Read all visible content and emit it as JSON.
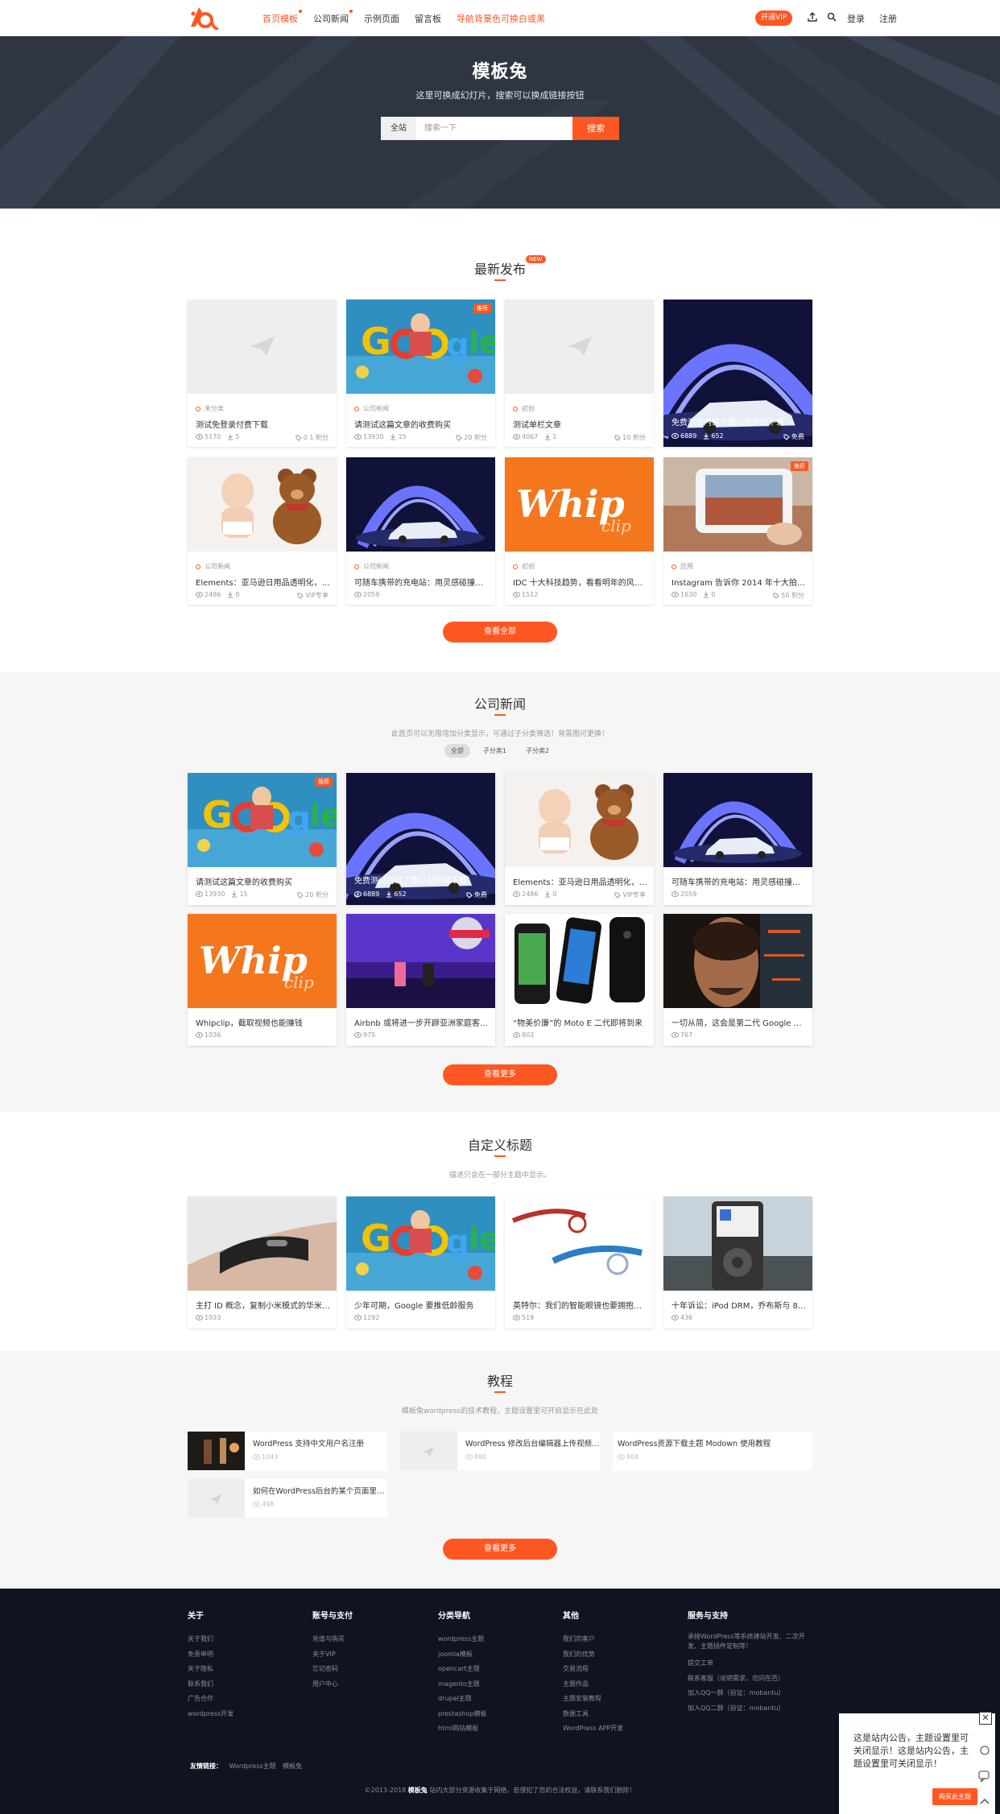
{
  "nav": {
    "items": [
      {
        "label": "首页模板",
        "active": true,
        "dot": true
      },
      {
        "label": "公司新闻",
        "dot": true
      },
      {
        "label": "示例页面"
      },
      {
        "label": "留言板"
      },
      {
        "label": "导航背景色可换白或黑",
        "highlight": true
      }
    ],
    "vip": "开通VIP",
    "login": "登录",
    "register": "注册"
  },
  "hero": {
    "title": "模板兔",
    "subtitle": "这里可换成幻灯片，搜索可以换成链接按钮",
    "search_scope": "全站",
    "search_placeholder": "搜索一下",
    "search_button": "搜索"
  },
  "latest": {
    "title": "最新发布",
    "badge": "NEW",
    "more": "查看全部",
    "cards": [
      {
        "cat": "未分类",
        "title": "测试免登录付费下载",
        "views": "5170",
        "downloads": "5",
        "price": "0.1 积分",
        "img": "placeholder"
      },
      {
        "cat": "公司新闻",
        "title": "请测试这篇文章的收费购买",
        "views": "13930",
        "downloads": "15",
        "price": "20 积分",
        "img": "google",
        "rec": "推荐"
      },
      {
        "cat": "初创",
        "title": "测试单栏文章",
        "views": "4067",
        "downloads": "1",
        "price": "10 积分",
        "img": "placeholder"
      },
      {
        "title": "免费测试内链下载以及外链下载",
        "views": "6889",
        "downloads": "652",
        "price": "免费",
        "img": "car",
        "overlay": true
      },
      {
        "cat": "公司新闻",
        "title": "Elements：亚马逊日用品透明化，…",
        "views": "2486",
        "downloads": "0",
        "price": "VIP专享",
        "img": "baby"
      },
      {
        "cat": "公司新闻",
        "title": "可随车携带的充电站：用灵感碰撞优雅",
        "views": "2059",
        "img": "car"
      },
      {
        "cat": "初创",
        "title": "IDC 十大科技趋势，看看明年的风往…",
        "views": "1512",
        "img": "whip"
      },
      {
        "cat": "应用",
        "title": "Instagram 告诉你 2014 年十大拍照…",
        "views": "1630",
        "downloads": "0",
        "price": "50 积分",
        "img": "phone",
        "rec": "推荐"
      }
    ]
  },
  "news": {
    "title": "公司新闻",
    "desc": "此首页可以无限增加分类显示，可通过子分类筛选！背景图可更换！",
    "filters": [
      "全部",
      "子分类1",
      "子分类2"
    ],
    "more": "查看更多",
    "cards": [
      {
        "title": "请测试这篇文章的收费购买",
        "views": "13930",
        "downloads": "15",
        "price": "20 积分",
        "img": "google",
        "rec": "推荐"
      },
      {
        "title": "免费测试内链下载以及外链下载",
        "views": "6889",
        "downloads": "652",
        "price": "免费",
        "img": "car",
        "overlay": true
      },
      {
        "title": "Elements：亚马逊日用品透明化，…",
        "views": "2486",
        "downloads": "0",
        "price": "VIP专享",
        "img": "baby"
      },
      {
        "title": "可随车携带的充电站：用灵感碰撞优雅",
        "views": "2059",
        "img": "car"
      },
      {
        "title": "Whipclip，截取视频也能赚钱",
        "views": "1036",
        "img": "whip"
      },
      {
        "title": "Airbnb 或将进一步开辟亚洲家庭客…",
        "views": "975",
        "img": "stage"
      },
      {
        "title": "“物美价廉”的 Moto E 二代即将到来",
        "views": "803",
        "img": "moto"
      },
      {
        "title": "一切从简，这会是第二代 Google Gl…",
        "views": "767",
        "img": "ironman"
      }
    ]
  },
  "custom": {
    "title": "自定义标题",
    "desc": "描述只会在一部分主题中显示。",
    "cards": [
      {
        "title": "主打 ID 概念，复制小米模式的华米…",
        "views": "1033",
        "img": "band"
      },
      {
        "title": "少年可期，Google 要推低龄服务",
        "views": "1292",
        "img": "google"
      },
      {
        "title": "英特尔：我们的智能眼镜也要拥抱时尚",
        "views": "519",
        "img": "glasses"
      },
      {
        "title": "十年诉讼：iPod DRM，乔布斯与 8…",
        "views": "436",
        "img": "ipod"
      }
    ]
  },
  "tutorial": {
    "title": "教程",
    "desc": "模板兔wordpress的技术教程，主题设置里可开启显示在此处",
    "more": "查看更多",
    "items": [
      {
        "title": "WordPress 支持中文用户名注册",
        "views": "1043",
        "img": "dark"
      },
      {
        "title": "WordPress 修改后台编辑器上传视频…",
        "views": "880",
        "img": "placeholder"
      },
      {
        "title": "WordPress资源下载主题 Modown 使用教程",
        "views": "804"
      },
      {
        "title": "如何在WordPress后台的某个页面里…",
        "views": "498",
        "img": "placeholder"
      }
    ]
  },
  "footer": {
    "cols": [
      {
        "head": "关于",
        "links": [
          "关于我们",
          "免责申明",
          "关于隐私",
          "联系我们",
          "广告合作",
          "wordpress开发"
        ]
      },
      {
        "head": "账号与支付",
        "links": [
          "充值与购买",
          "关于VIP",
          "忘记密码",
          "用户中心"
        ]
      },
      {
        "head": "分类导航",
        "links": [
          "wordpress主题",
          "joomla模板",
          "opencart主题",
          "magento主题",
          "drupal主题",
          "prestashop模板",
          "html网站模板"
        ]
      },
      {
        "head": "其他",
        "links": [
          "我们的客户",
          "我们的优势",
          "交易流程",
          "主题作品",
          "主题安装教程",
          "数据工具",
          "WordPress APP开发"
        ]
      },
      {
        "head": "服务与支持",
        "links": [
          "承接WordPress等系统建站开发、二次开发、主题插件定制等！",
          "提交工单",
          "联系客服（说明需求，勿问在否）",
          "加入QQ一群（验证：mobantu）",
          "加入QQ二群（验证：mobantu）"
        ]
      }
    ],
    "friend_label": "友情链接：",
    "friends": [
      "Wordpress主题",
      "模板兔"
    ],
    "copyright_pre": "©2013-2018 ",
    "copyright_brand": "模板兔",
    "copyright_post": " 站内大部分资源收集于网络，若侵犯了您的合法权益，请联系我们删除！"
  },
  "notice": {
    "text": "这是站内公告，主题设置里可关闭显示！这是站内公告，主题设置里可关闭显示！",
    "button": "购买此主题"
  },
  "colors": {
    "accent": "#ff5722",
    "hero_bg": "#2f3642",
    "footer_bg": "#0f1420",
    "section_alt": "#f6f6f6"
  }
}
